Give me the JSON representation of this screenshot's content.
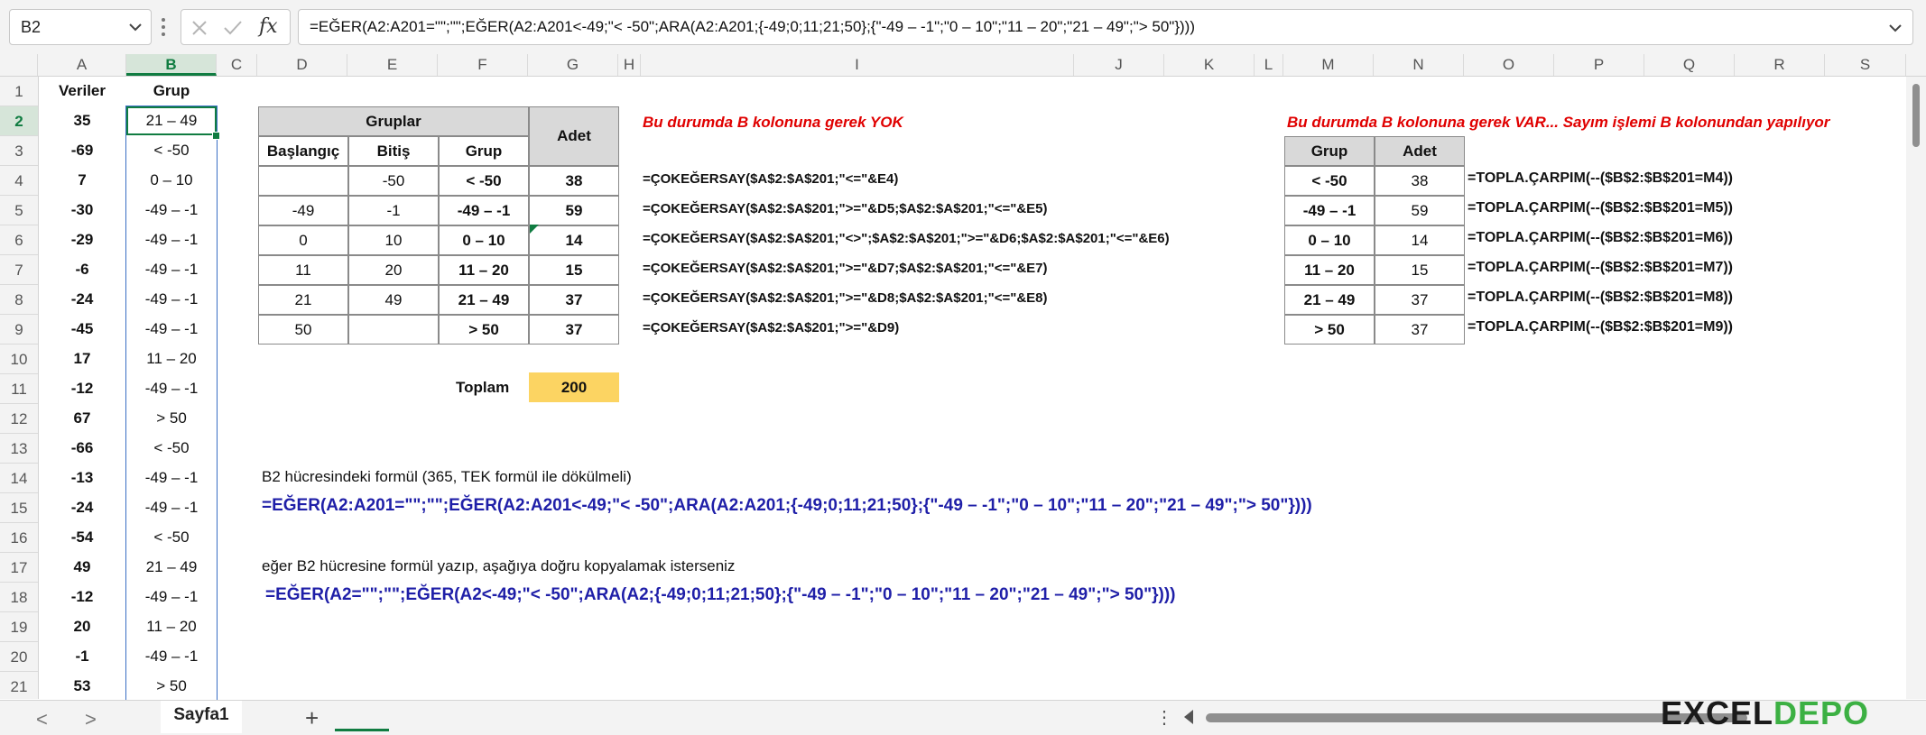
{
  "formula_bar": {
    "name_box": "B2",
    "fx": "fx",
    "formula": "=EĞER(A2:A201=\"\";\"\";EĞER(A2:A201<-49;\"< -50\";ARA(A2:A201;{-49;0;11;21;50};{\"-49 – -1\";\"0 – 10\";\"11 – 20\";\"21 – 49\";\"> 50\"})))"
  },
  "columns": [
    "A",
    "B",
    "C",
    "D",
    "E",
    "F",
    "G",
    "H",
    "I",
    "J",
    "K",
    "L",
    "M",
    "N",
    "O",
    "P",
    "Q",
    "R",
    "S"
  ],
  "rows": [
    "1",
    "2",
    "3",
    "4",
    "5",
    "6",
    "7",
    "8",
    "9",
    "10",
    "11",
    "12",
    "13",
    "14",
    "15",
    "16",
    "17",
    "18",
    "19",
    "20",
    "21"
  ],
  "data": {
    "header_a": "Veriler",
    "header_b": "Grup",
    "values": [
      "35",
      "-69",
      "7",
      "-30",
      "-29",
      "-6",
      "-24",
      "-45",
      "17",
      "-12",
      "67",
      "-66",
      "-13",
      "-24",
      "-54",
      "49",
      "-12",
      "20",
      "-1",
      "53"
    ],
    "groups": [
      "21 – 49",
      "< -50",
      "0 – 10",
      "-49 – -1",
      "-49 – -1",
      "-49 – -1",
      "-49 – -1",
      "-49 – -1",
      "11 – 20",
      "-49 – -1",
      "> 50",
      "< -50",
      "-49 – -1",
      "-49 – -1",
      "< -50",
      "21 – 49",
      "-49 – -1",
      "11 – 20",
      "-49 – -1",
      "> 50"
    ]
  },
  "groups_table": {
    "title": "Gruplar",
    "count_header": "Adet",
    "col_start": "Başlangıç",
    "col_end": "Bitiş",
    "col_group": "Grup",
    "rows": [
      {
        "start": "",
        "end": "-50",
        "group": "< -50",
        "count": "38",
        "formula": "=ÇOKEĞERSAY($A$2:$A$201;\"<=\"&E4)"
      },
      {
        "start": "-49",
        "end": "-1",
        "group": "-49 – -1",
        "count": "59",
        "formula": "=ÇOKEĞERSAY($A$2:$A$201;\">=\"&D5;$A$2:$A$201;\"<=\"&E5)"
      },
      {
        "start": "0",
        "end": "10",
        "group": "0 – 10",
        "count": "14",
        "formula": "=ÇOKEĞERSAY($A$2:$A$201;\"<>\";$A$2:$A$201;\">=\"&D6;$A$2:$A$201;\"<=\"&E6)"
      },
      {
        "start": "11",
        "end": "20",
        "group": "11 – 20",
        "count": "15",
        "formula": "=ÇOKEĞERSAY($A$2:$A$201;\">=\"&D7;$A$2:$A$201;\"<=\"&E7)"
      },
      {
        "start": "21",
        "end": "49",
        "group": "21 – 49",
        "count": "37",
        "formula": "=ÇOKEĞERSAY($A$2:$A$201;\">=\"&D8;$A$2:$A$201;\"<=\"&E8)"
      },
      {
        "start": "50",
        "end": "",
        "group": "> 50",
        "count": "37",
        "formula": "=ÇOKEĞERSAY($A$2:$A$201;\">=\"&D9)"
      }
    ],
    "total_label": "Toplam",
    "total_value": "200",
    "note": "Bu durumda B kolonuna gerek YOK"
  },
  "right_table": {
    "note": "Bu durumda B kolonuna gerek VAR... Sayım işlemi B kolonundan yapılıyor",
    "col_group": "Grup",
    "col_count": "Adet",
    "rows": [
      {
        "group": "< -50",
        "count": "38",
        "formula": "=TOPLA.ÇARPIM(--($B$2:$B$201=M4))"
      },
      {
        "group": "-49 – -1",
        "count": "59",
        "formula": "=TOPLA.ÇARPIM(--($B$2:$B$201=M5))"
      },
      {
        "group": "0 – 10",
        "count": "14",
        "formula": "=TOPLA.ÇARPIM(--($B$2:$B$201=M6))"
      },
      {
        "group": "11 – 20",
        "count": "15",
        "formula": "=TOPLA.ÇARPIM(--($B$2:$B$201=M7))"
      },
      {
        "group": "21 – 49",
        "count": "37",
        "formula": "=TOPLA.ÇARPIM(--($B$2:$B$201=M8))"
      },
      {
        "group": "> 50",
        "count": "37",
        "formula": "=TOPLA.ÇARPIM(--($B$2:$B$201=M9))"
      }
    ]
  },
  "notes": {
    "b2_label": "B2 hücresindeki formül  (365, TEK formül ile dökülmeli)",
    "b2_formula": "=EĞER(A2:A201=\"\";\"\";EĞER(A2:A201<-49;\"< -50\";ARA(A2:A201;{-49;0;11;21;50};{\"-49 – -1\";\"0 – 10\";\"11 – 20\";\"21 – 49\";\"> 50\"})))",
    "copy_label": "eğer B2 hücresine formül yazıp,  aşağıya doğru kopyalamak isterseniz",
    "copy_formula": "=EĞER(A2=\"\";\"\";EĞER(A2<-49;\"< -50\";ARA(A2;{-49;0;11;21;50};{\"-49 – -1\";\"0 – 10\";\"11 – 20\";\"21 – 49\";\"> 50\"})))"
  },
  "sheet_bar": {
    "tab": "Sayfa1",
    "add": "+",
    "more": "⋮",
    "prev": "<",
    "next": ">"
  },
  "logo": {
    "part1": "EXCEL",
    "part2": "DEPO"
  },
  "colors": {
    "accent": "#107c41",
    "note_red": "#e00000",
    "formula_navy": "#1f1fa8",
    "total_fill": "#fcd462",
    "header_fill": "#d9d9d9"
  }
}
